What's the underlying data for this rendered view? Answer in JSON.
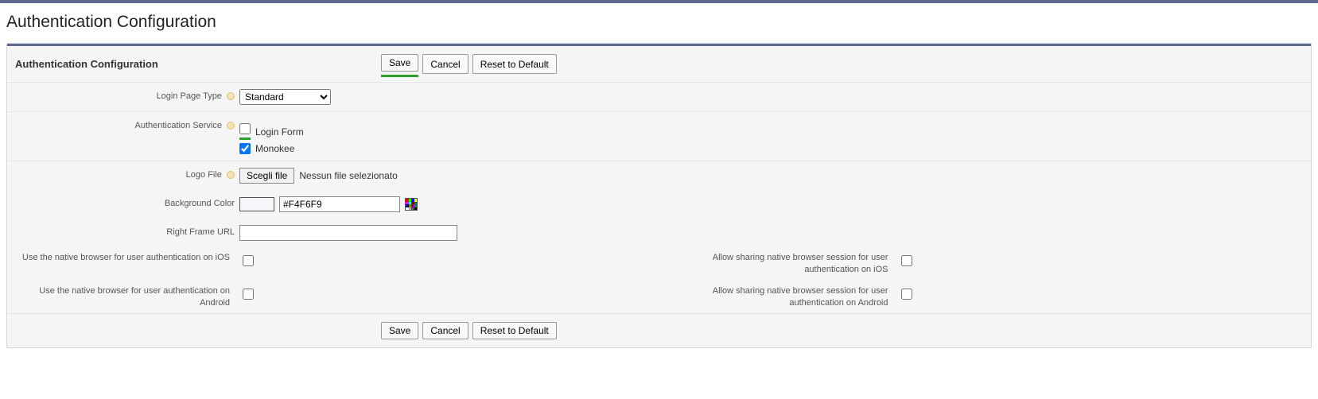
{
  "page_title": "Authentication Configuration",
  "panel_title": "Authentication Configuration",
  "buttons": {
    "save": "Save",
    "cancel": "Cancel",
    "reset": "Reset to Default"
  },
  "fields": {
    "login_page_type": {
      "label": "Login Page Type",
      "value": "Standard"
    },
    "authentication_service": {
      "label": "Authentication Service",
      "options": [
        {
          "label": "Login Form",
          "checked": false
        },
        {
          "label": "Monokee",
          "checked": true
        }
      ]
    },
    "logo_file": {
      "label": "Logo File",
      "button": "Scegli file",
      "status": "Nessun file selezionato"
    },
    "background_color": {
      "label": "Background Color",
      "value": "#F4F6F9"
    },
    "right_frame_url": {
      "label": "Right Frame URL",
      "value": ""
    },
    "native_ios": {
      "label": "Use the native browser for user authentication on iOS",
      "checked": false
    },
    "share_ios": {
      "label": "Allow sharing native browser session for user authentication on iOS",
      "checked": false
    },
    "native_android": {
      "label": "Use the native browser for user authentication on Android",
      "checked": false
    },
    "share_android": {
      "label": "Allow sharing native browser session for user authentication on Android",
      "checked": false
    }
  }
}
